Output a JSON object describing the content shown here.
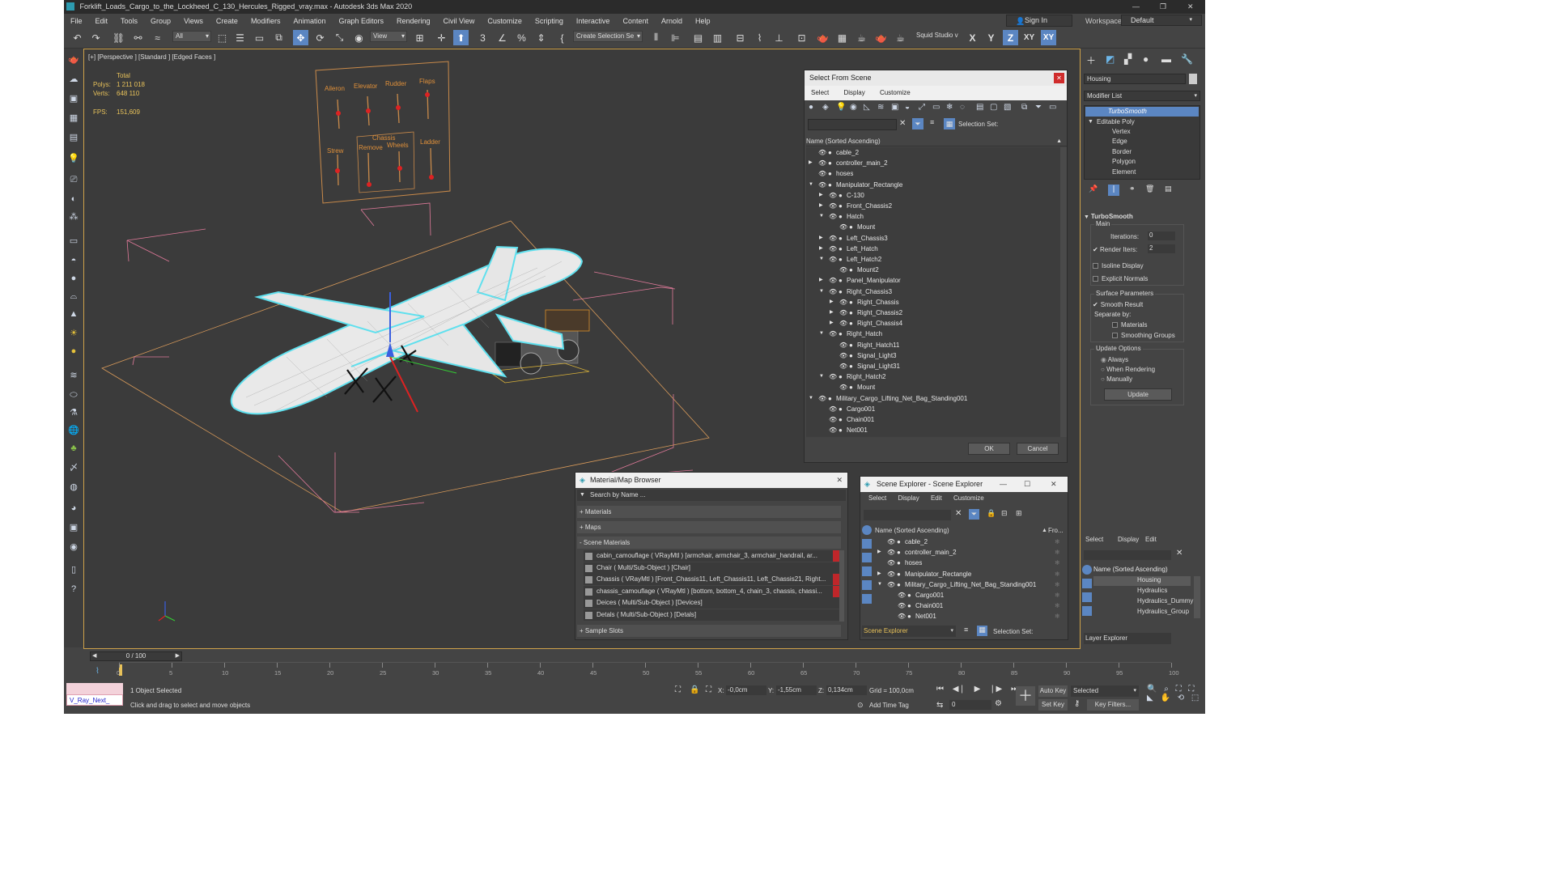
{
  "window": {
    "title": "Forklift_Loads_Cargo_to_the_Lockheed_C_130_Hercules_Rigged_vray.max - Autodesk 3ds Max 2020",
    "controls": [
      "—",
      "❐",
      "✕"
    ]
  },
  "menu": [
    "File",
    "Edit",
    "Tools",
    "Group",
    "Views",
    "Create",
    "Modifiers",
    "Animation",
    "Graph Editors",
    "Rendering",
    "Civil View",
    "Customize",
    "Scripting",
    "Interactive",
    "Content",
    "Arnold",
    "Help"
  ],
  "account": {
    "sign_in": "Sign In",
    "workspaces_label": "Workspaces:",
    "workspace": "Default"
  },
  "toolbar": {
    "filter": "All",
    "ref_coord": "View",
    "selection_set": "Create Selection Se",
    "squid": "Squid Studio v",
    "axes": [
      "X",
      "Y",
      "Z",
      "XY",
      "XY"
    ]
  },
  "viewport": {
    "label": "[+] [Perspective ] [Standard ] [Edged Faces ]",
    "stats": {
      "total": "Total",
      "polys_label": "Polys:",
      "polys": "1 211 018",
      "verts_label": "Verts:",
      "verts": "648 110",
      "fps_label": "FPS:",
      "fps": "151,609"
    },
    "panel_labels": [
      "Aileron",
      "Elevator",
      "Rudder",
      "Flaps",
      "Strew",
      "Chassis",
      "Remove",
      "Wheels",
      "Ladder"
    ]
  },
  "select_from_scene": {
    "title": "Select From Scene",
    "tabs": [
      "Select",
      "Display",
      "Customize"
    ],
    "selection_set": "Selection Set:",
    "column": "Name (Sorted Ascending)",
    "ok": "OK",
    "cancel": "Cancel",
    "rows": [
      {
        "name": "cable_2",
        "depth": 0,
        "exp": ""
      },
      {
        "name": "controller_main_2",
        "depth": 0,
        "exp": "▶"
      },
      {
        "name": "hoses",
        "depth": 0,
        "exp": ""
      },
      {
        "name": "Manipulator_Rectangle",
        "depth": 0,
        "exp": "▼"
      },
      {
        "name": "C-130",
        "depth": 1,
        "exp": "▶"
      },
      {
        "name": "Front_Chassis2",
        "depth": 1,
        "exp": "▶"
      },
      {
        "name": "Hatch",
        "depth": 1,
        "exp": "▼"
      },
      {
        "name": "Mount",
        "depth": 2,
        "exp": ""
      },
      {
        "name": "Left_Chassis3",
        "depth": 1,
        "exp": "▶"
      },
      {
        "name": "Left_Hatch",
        "depth": 1,
        "exp": "▶"
      },
      {
        "name": "Left_Hatch2",
        "depth": 1,
        "exp": "▼"
      },
      {
        "name": "Mount2",
        "depth": 2,
        "exp": ""
      },
      {
        "name": "Panel_Manipulator",
        "depth": 1,
        "exp": "▶"
      },
      {
        "name": "Right_Chassis3",
        "depth": 1,
        "exp": "▼"
      },
      {
        "name": "Right_Chassis",
        "depth": 2,
        "exp": "▶"
      },
      {
        "name": "Right_Chassis2",
        "depth": 2,
        "exp": "▶"
      },
      {
        "name": "Right_Chassis4",
        "depth": 2,
        "exp": "▶"
      },
      {
        "name": "Right_Hatch",
        "depth": 1,
        "exp": "▼"
      },
      {
        "name": "Right_Hatch11",
        "depth": 2,
        "exp": ""
      },
      {
        "name": "Signal_Light3",
        "depth": 2,
        "exp": ""
      },
      {
        "name": "Signal_Light31",
        "depth": 2,
        "exp": ""
      },
      {
        "name": "Right_Hatch2",
        "depth": 1,
        "exp": "▼"
      },
      {
        "name": "Mount",
        "depth": 2,
        "exp": ""
      },
      {
        "name": "Military_Cargo_Lifting_Net_Bag_Standing001",
        "depth": 0,
        "exp": "▼"
      },
      {
        "name": "Cargo001",
        "depth": 1,
        "exp": ""
      },
      {
        "name": "Chain001",
        "depth": 1,
        "exp": ""
      },
      {
        "name": "Net001",
        "depth": 1,
        "exp": ""
      }
    ]
  },
  "material_browser": {
    "title": "Material/Map Browser",
    "search": "Search by Name ...",
    "sections": [
      "+ Materials",
      "+ Maps",
      "- Scene Materials"
    ],
    "items": [
      "cabin_camouflage ( VRayMtl ) [armchair, armchair_3, armchair_handrail, ar...",
      "Chair ( Multi/Sub-Object ) [Chair]",
      "Chassis ( VRayMtl ) [Front_Chassis11, Left_Chassis11, Left_Chassis21, Right...",
      "chassis_camouflage ( VRayMtl ) [bottom, bottom_4, chain_3, chassis, chassi...",
      "Deices ( Multi/Sub-Object ) [Devices]",
      "Detals ( Multi/Sub-Object ) [Detals]"
    ],
    "sample_slots": "+ Sample Slots"
  },
  "scene_explorer": {
    "title": "Scene Explorer - Scene Explorer",
    "tabs": [
      "Select",
      "Display",
      "Edit",
      "Customize"
    ],
    "column": "Name (Sorted Ascending)",
    "frozen": "Fro...",
    "footer_name": "Scene Explorer",
    "selection_set": "Selection Set:",
    "rows": [
      {
        "name": "cable_2",
        "depth": 0,
        "exp": ""
      },
      {
        "name": "controller_main_2",
        "depth": 0,
        "exp": "▶"
      },
      {
        "name": "hoses",
        "depth": 0,
        "exp": ""
      },
      {
        "name": "Manipulator_Rectangle",
        "depth": 0,
        "exp": "▶"
      },
      {
        "name": "Military_Cargo_Lifting_Net_Bag_Standing001",
        "depth": 0,
        "exp": "▼"
      },
      {
        "name": "Cargo001",
        "depth": 1,
        "exp": ""
      },
      {
        "name": "Chain001",
        "depth": 1,
        "exp": ""
      },
      {
        "name": "Net001",
        "depth": 1,
        "exp": ""
      }
    ]
  },
  "command_panel": {
    "object_name": "Housing",
    "modifier_list": "Modifier List",
    "stack": [
      "TurboSmooth",
      "Editable Poly",
      "Vertex",
      "Edge",
      "Border",
      "Polygon",
      "Element"
    ],
    "turbosmooth": {
      "title": "TurboSmooth",
      "main": "Main",
      "iterations_label": "Iterations:",
      "iterations": "0",
      "render_iters_label": "Render Iters:",
      "render_iters": "2",
      "isoline": "Isoline Display",
      "explicit": "Explicit Normals",
      "surface": "Surface Parameters",
      "smooth_result": "Smooth Result",
      "separate_by": "Separate by:",
      "materials": "Materials",
      "smoothing_groups": "Smoothing Groups",
      "update_options": "Update Options",
      "always": "Always",
      "when_rendering": "When Rendering",
      "manually": "Manually",
      "update": "Update"
    }
  },
  "layer_explorer": {
    "tabs": [
      "Select",
      "Display",
      "Edit"
    ],
    "column": "Name (Sorted Ascending)",
    "rows": [
      "Housing",
      "Hydraulics",
      "Hydraulics_Dummy",
      "Hydraulics_Group"
    ],
    "footer": "Layer Explorer"
  },
  "timeline": {
    "frame": "0 / 100",
    "ticks": [
      "0",
      "5",
      "10",
      "15",
      "20",
      "25",
      "30",
      "35",
      "40",
      "45",
      "50",
      "55",
      "60",
      "65",
      "70",
      "75",
      "80",
      "85",
      "90",
      "95",
      "100"
    ]
  },
  "status": {
    "script_listener": "V_Ray_Next_",
    "selected": "1 Object Selected",
    "prompt": "Click and drag to select and move objects",
    "x_label": "X:",
    "x": "-0,0cm",
    "y_label": "Y:",
    "y": "-1,55cm",
    "z_label": "Z:",
    "z": "0,134cm",
    "grid": "Grid = 100,0cm",
    "add_time_tag": "Add Time Tag",
    "auto_key": "Auto Key",
    "set_key": "Set Key",
    "selected_mode": "Selected",
    "key_filters": "Key Filters...",
    "frame": "0"
  },
  "colors": {
    "accent": "#5b86c2",
    "viewport_border": "#cfa24a",
    "wire_select": "#5fe0ee",
    "stats_text": "#e8c25a"
  }
}
